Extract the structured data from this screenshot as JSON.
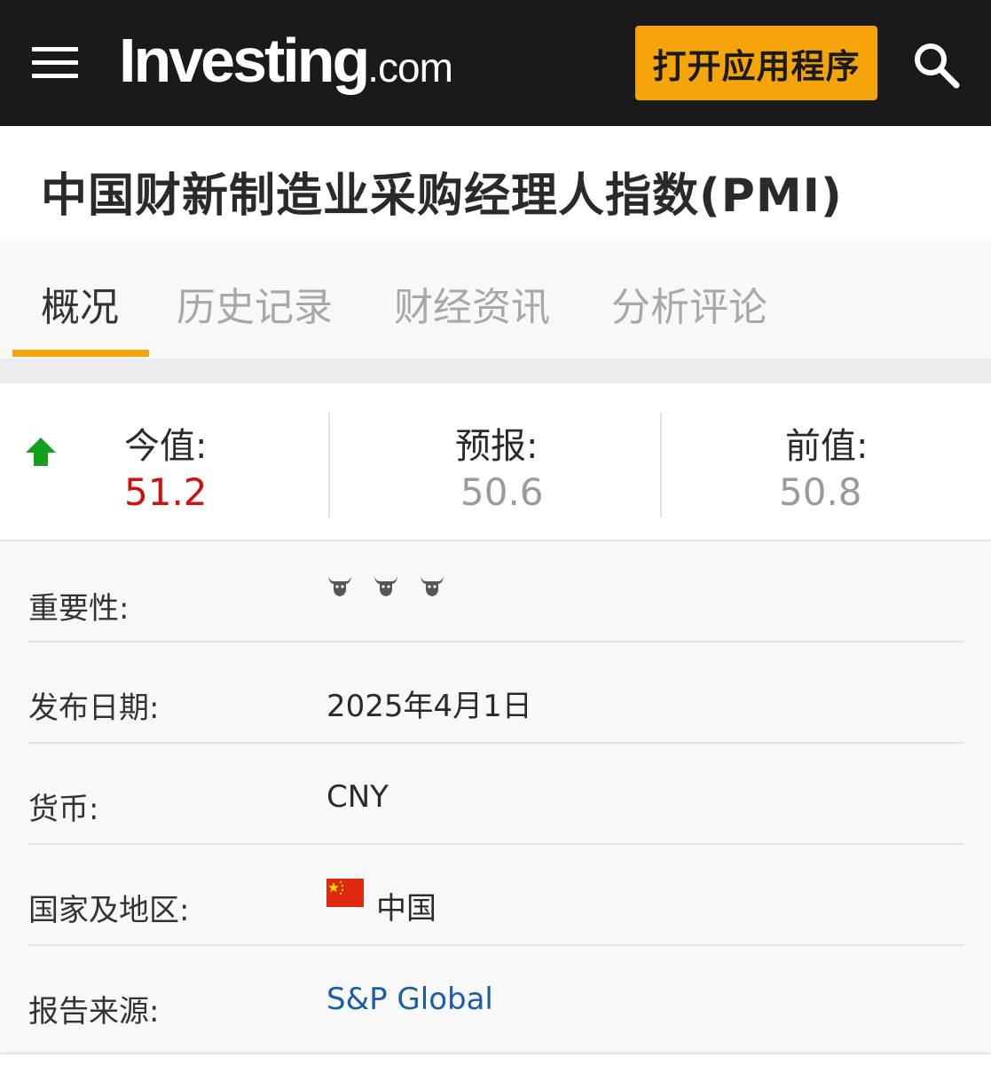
{
  "header": {
    "brand": "Investing",
    "brand_suffix": ".com",
    "open_app_label": "打开应用程序",
    "accent_color": "#f5a40a"
  },
  "page": {
    "title": "中国财新制造业采购经理人指数(PMI)"
  },
  "tabs": [
    {
      "label": "概况",
      "active": true
    },
    {
      "label": "历史记录",
      "active": false
    },
    {
      "label": "财经资讯",
      "active": false
    },
    {
      "label": "分析评论",
      "active": false
    }
  ],
  "values": {
    "trend_icon": "up-arrow-icon",
    "actual_label": "今值:",
    "actual": "51.2",
    "forecast_label": "预报:",
    "forecast": "50.6",
    "previous_label": "前值:",
    "previous": "50.8",
    "actual_color": "#d01010",
    "trend_color": "#14a01e"
  },
  "details": {
    "importance": {
      "label": "重要性:",
      "level": 3,
      "max": 3,
      "icon": "bull-icon"
    },
    "release_date": {
      "label": "发布日期:",
      "value": "2025年4月1日"
    },
    "currency": {
      "label": "货币:",
      "value": "CNY"
    },
    "country": {
      "label": "国家及地区:",
      "value": "中国",
      "flag_icon": "china-flag-icon"
    },
    "source": {
      "label": "报告来源:",
      "value": "S&P Global",
      "link_color": "#1a5fa6"
    }
  }
}
